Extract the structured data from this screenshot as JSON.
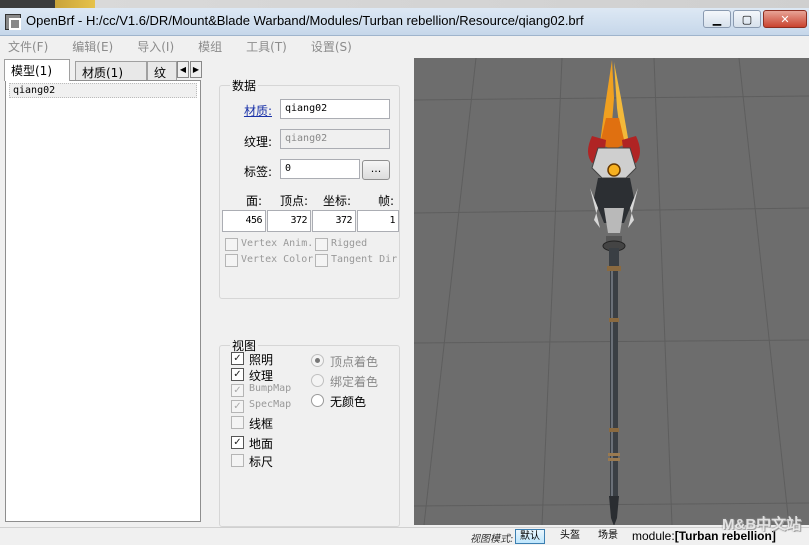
{
  "window": {
    "title": "OpenBrf - H:/cc/V1.6/DR/Mount&Blade Warband/Modules/Turban rebellion/Resource/qiang02.brf",
    "minimize_label": "▁",
    "maximize_label": "▢",
    "close_label": "✕"
  },
  "menu": [
    "文件(F)",
    "编辑(E)",
    "导入(I)",
    "模组",
    "工具(T)",
    "设置(S)"
  ],
  "tabs": [
    "模型(1)",
    "材质(1)",
    "纹"
  ],
  "tab_scroll": {
    "left": "◀",
    "right": "▶"
  },
  "list": {
    "items": [
      "qiang02"
    ]
  },
  "data_group": {
    "title": "数据",
    "material_label": "材质:",
    "material_value": "qiang02",
    "texture_label": "纹理:",
    "texture_value": "qiang02",
    "tag_label": "标签:",
    "tag_value": "0",
    "dots_label": "...",
    "stats_headers": [
      "面:",
      "顶点:",
      "坐标:",
      "帧:"
    ],
    "stats_values": [
      "456",
      "372",
      "372",
      "1"
    ],
    "flags": [
      "Vertex Anim.",
      "Rigged",
      "Vertex Color",
      "Tangent Dir"
    ]
  },
  "view_group": {
    "title": "视图",
    "checks": [
      {
        "label": "照明",
        "checked": true,
        "enabled": true
      },
      {
        "label": "纹理",
        "checked": true,
        "enabled": true
      },
      {
        "label": "BumpMap",
        "checked": true,
        "enabled": false
      },
      {
        "label": "SpecMap",
        "checked": true,
        "enabled": false
      },
      {
        "label": "线框",
        "checked": false,
        "enabled": true
      },
      {
        "label": "地面",
        "checked": true,
        "enabled": true
      },
      {
        "label": "标尺",
        "checked": false,
        "enabled": true
      }
    ],
    "radios": [
      {
        "label": "顶点着色",
        "selected": true,
        "enabled": false
      },
      {
        "label": "绑定着色",
        "selected": false,
        "enabled": false
      },
      {
        "label": "无颜色",
        "selected": false,
        "enabled": true
      }
    ],
    "check_mark": "✓"
  },
  "status": {
    "view_mode_label": "视图模式:",
    "buttons": [
      "默认",
      "头盔",
      "场景"
    ],
    "module_label": "module:",
    "module_value": "[Turban rebellion]",
    "watermark": "M&B中文站"
  },
  "colors": {
    "viewport_bg": "#6d6d6d",
    "grid": "#595959",
    "blade": "#e8a020",
    "guard": "#a82020",
    "shaft": "#3a3f44"
  }
}
